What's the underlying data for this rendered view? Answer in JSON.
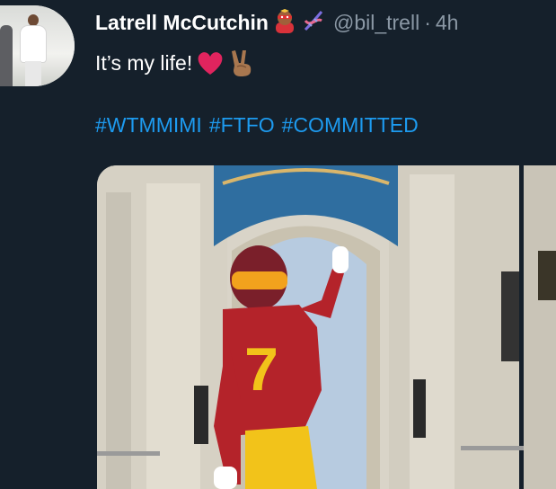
{
  "tweet": {
    "display_name": "Latrell McCutchin",
    "handle": "@bil_trell",
    "separator": "·",
    "timestamp": "4h",
    "text": "It’s my life!",
    "name_emojis": [
      "superhero-emoji",
      "dna-emoji"
    ],
    "text_emojis": [
      "red-heart-emoji",
      "victory-hand-emoji"
    ],
    "hashtags": [
      "#WTMMIMI",
      "#FTFO",
      "#COMMITTED"
    ],
    "jersey_number": "7"
  },
  "colors": {
    "background": "#15202b",
    "name": "#ffffff",
    "secondary": "#8b98a5",
    "link": "#1d9bf0",
    "jersey": "#b4232a",
    "gold": "#f2c31a"
  }
}
